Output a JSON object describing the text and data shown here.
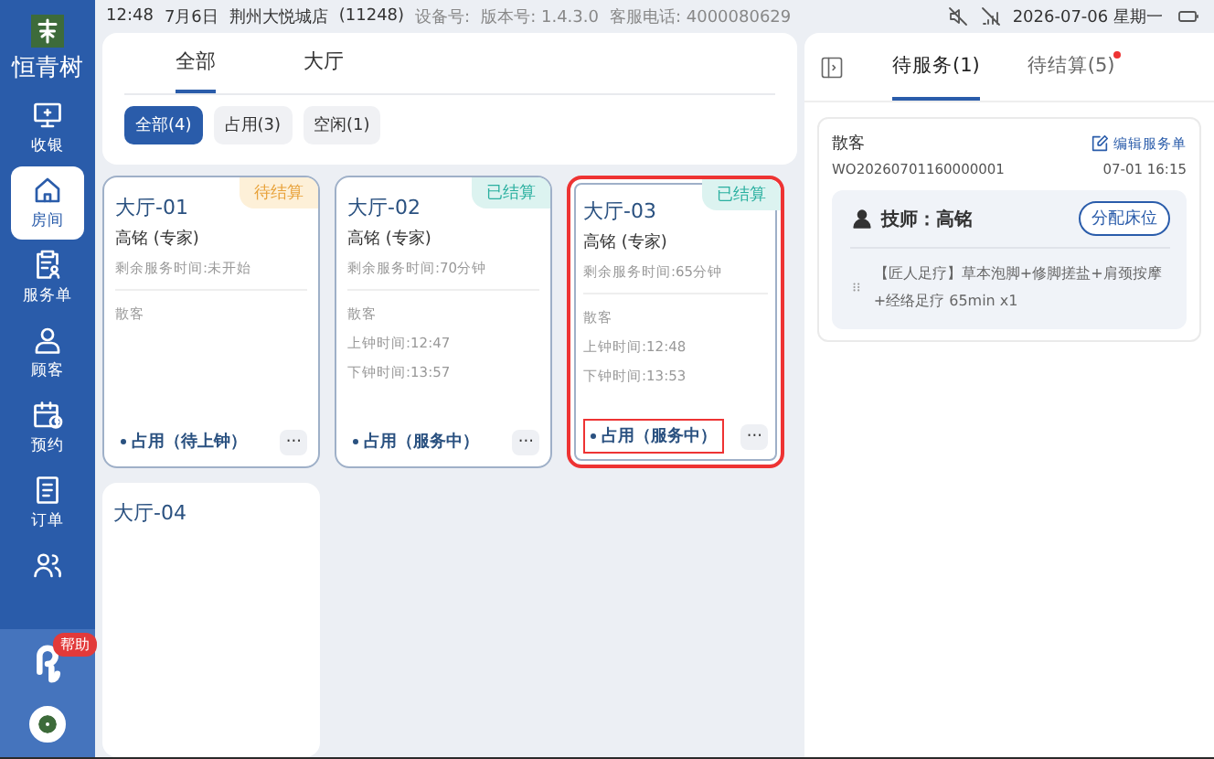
{
  "status_bar": {
    "time": "12:48",
    "date": "7月6日",
    "store": "荆州大悦城店",
    "store_code": "(11248)",
    "device_label": "设备号:",
    "version": "版本号: 1.4.3.0",
    "hotline": "客服电话: 4000080629",
    "datetime": "2026-07-06 星期一"
  },
  "sidebar": {
    "brand": "恒青树",
    "items": [
      {
        "label": "收银",
        "selected": false
      },
      {
        "label": "房间",
        "selected": true
      },
      {
        "label": "服务单",
        "selected": false
      },
      {
        "label": "顾客",
        "selected": false
      },
      {
        "label": "预约",
        "selected": false
      },
      {
        "label": "订单",
        "selected": false
      },
      {
        "selected": false
      }
    ],
    "help_badge": "帮助"
  },
  "area_tabs": [
    {
      "label": "全部",
      "selected": true
    },
    {
      "label": "大厅",
      "selected": false
    }
  ],
  "filters": [
    {
      "label": "全部(4)",
      "selected": true
    },
    {
      "label": "占用(3)",
      "selected": false
    },
    {
      "label": "空闲(1)",
      "selected": false
    }
  ],
  "rooms": [
    {
      "name": "大厅-01",
      "badge": "待结算",
      "kind": "pending",
      "therapist": "高铭 (专家)",
      "remaining": "剩余服务时间:未开始",
      "customer": "散客",
      "status": "占用（待上钟）",
      "more": "···",
      "highlighted": false
    },
    {
      "name": "大厅-02",
      "badge": "已结算",
      "kind": "settled",
      "therapist": "高铭 (专家)",
      "remaining": "剩余服务时间:70分钟",
      "customer": "散客",
      "start": "上钟时间:12:47",
      "end": "下钟时间:13:57",
      "status": "占用（服务中）",
      "more": "···",
      "highlighted": false
    },
    {
      "name": "大厅-03",
      "badge": "已结算",
      "kind": "settled",
      "therapist": "高铭 (专家)",
      "remaining": "剩余服务时间:65分钟",
      "customer": "散客",
      "start": "上钟时间:12:48",
      "end": "下钟时间:13:53",
      "status": "占用（服务中）",
      "more": "···",
      "highlighted": true
    },
    {
      "name": "大厅-04",
      "kind": "empty",
      "highlighted": false
    }
  ],
  "panel": {
    "tabs": [
      {
        "label": "待服务(1)",
        "selected": true,
        "dot": false
      },
      {
        "label": "待结算(5)",
        "selected": false,
        "dot": true
      }
    ],
    "order": {
      "customer": "散客",
      "edit": "编辑服务单",
      "number": "WO20260701160000001",
      "time": "07-01 16:15",
      "therapist": "技师：高铭",
      "assign": "分配床位",
      "item": "【匠人足疗】草本泡脚+修脚搓盐+肩颈按摩+经络足疗 65min x1"
    }
  }
}
